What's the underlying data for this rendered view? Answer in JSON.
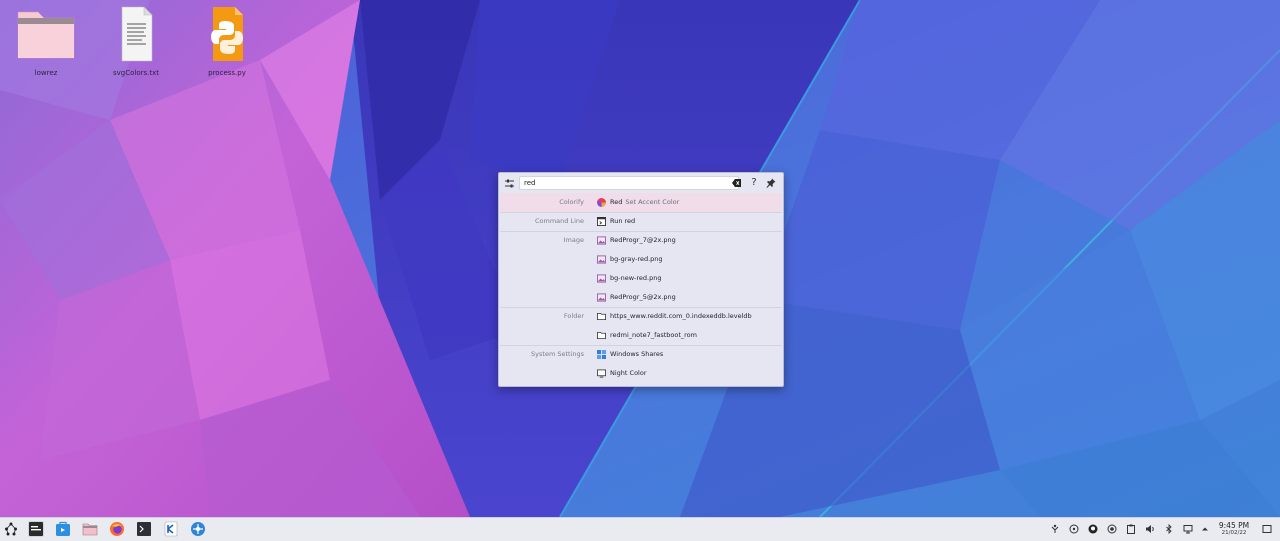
{
  "desktop": {
    "icons": [
      {
        "label": "lowrez",
        "icon": "folder-icon"
      },
      {
        "label": "svgColors.txt",
        "icon": "text-file-icon"
      },
      {
        "label": "process.py",
        "icon": "python-file-icon"
      }
    ]
  },
  "runner": {
    "search": {
      "value": "red",
      "placeholder": ""
    },
    "buttons": {
      "help": "?"
    },
    "results": [
      {
        "category": "Colorify",
        "title": "Red",
        "subtitle": "Set Accent Color",
        "icon": "color-wheel-icon",
        "selected": true
      },
      {
        "category": "Command Line",
        "title": "Run red",
        "icon": "terminal-icon"
      },
      {
        "category": "Image",
        "title": "RedProgr_7@2x.png",
        "icon": "image-icon"
      },
      {
        "category": "",
        "title": "bg-gray-red.png",
        "icon": "image-icon"
      },
      {
        "category": "",
        "title": "bg-new-red.png",
        "icon": "image-icon"
      },
      {
        "category": "",
        "title": "RedProgr_5@2x.png",
        "icon": "image-icon"
      },
      {
        "category": "Folder",
        "title": "https_www.reddit.com_0.indexeddb.leveldb",
        "icon": "folder-icon"
      },
      {
        "category": "",
        "title": "redmi_note7_fastboot_rom",
        "icon": "folder-icon"
      },
      {
        "category": "System Settings",
        "title": "Windows Shares",
        "icon": "network-share-icon"
      },
      {
        "category": "",
        "title": "Night Color",
        "icon": "monitor-icon"
      }
    ]
  },
  "taskbar": {
    "apps": [
      "application-launcher-icon",
      "krunner-icon",
      "discover-icon",
      "dolphin-icon",
      "firefox-icon",
      "konsole-icon",
      "kate-icon",
      "network-icon"
    ],
    "clock": {
      "time": "9:45 PM",
      "date": "21/02/22"
    }
  },
  "colors": {
    "accent": "#f1dcea",
    "panel": "#e9ebf1",
    "runner_bg": "#e5e6f2"
  }
}
